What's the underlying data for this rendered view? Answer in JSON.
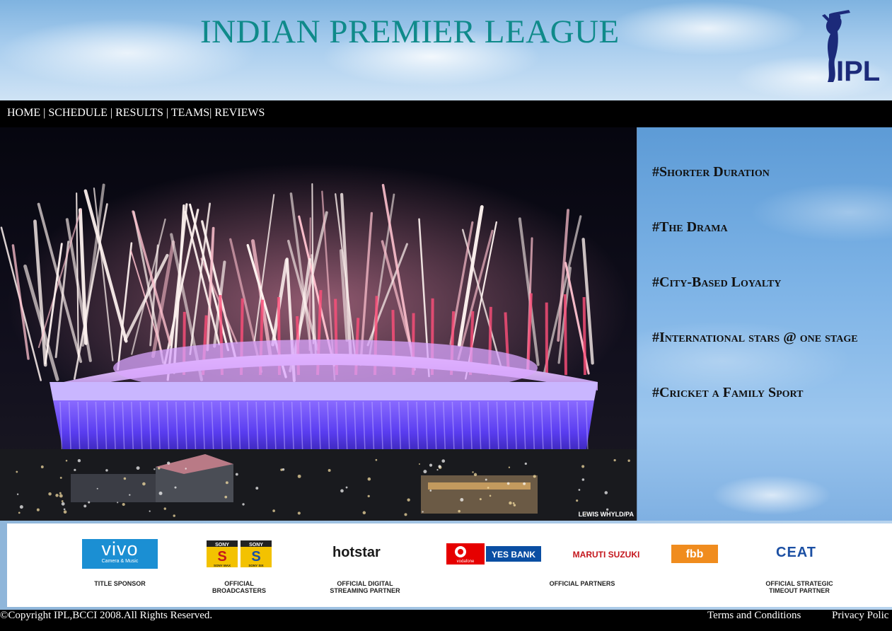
{
  "header": {
    "title": "INDIAN PREMIER LEAGUE",
    "logo_text": "IPL"
  },
  "nav": {
    "items": [
      "HOME",
      "SCHEDULE",
      "RESULTS",
      "TEAMS",
      "REVIEWS"
    ]
  },
  "hero": {
    "photo_credit": "LEWIS WHYLD/PA"
  },
  "side": {
    "tags": [
      "#Shorter Duration",
      "#The Drama",
      "#City-Based Loyalty",
      "#International stars @ one stage",
      "#Cricket a Family Sport"
    ]
  },
  "sponsors": {
    "title_sponsor": {
      "logo": "vivo",
      "logo_sub": "Camera & Music",
      "label": "TITLE SPONSOR"
    },
    "broadcasters": {
      "logos": [
        "SONY MAX",
        "SONY SIX"
      ],
      "label_line1": "OFFICIAL",
      "label_line2": "BROADCASTERS"
    },
    "streaming": {
      "logo": "hotstar",
      "label_line1": "OFFICIAL DIGITAL",
      "label_line2": "STREAMING PARTNER"
    },
    "partners": {
      "logos": [
        "vodafone",
        "YES BANK",
        "MARUTI SUZUKI",
        "fbb"
      ],
      "label": "OFFICIAL PARTNERS"
    },
    "strategic": {
      "logo": "CEAT",
      "label_line1": "OFFICIAL STRATEGIC",
      "label_line2": "TIMEOUT PARTNER"
    }
  },
  "footer": {
    "copyright": "©Copyright IPL,BCCI 2008.All Rights Reserved.",
    "terms": "Terms and Conditions",
    "privacy": "Privacy Polic"
  },
  "colors": {
    "title": "#0f8a8a",
    "nav_bg": "#000000",
    "vivo_blue": "#1b8fd3",
    "ipl_navy": "#1c2a7a",
    "ceat_blue": "#1b4fa3",
    "fbb_orange": "#f08c1e",
    "vodafone_red": "#e60000"
  }
}
